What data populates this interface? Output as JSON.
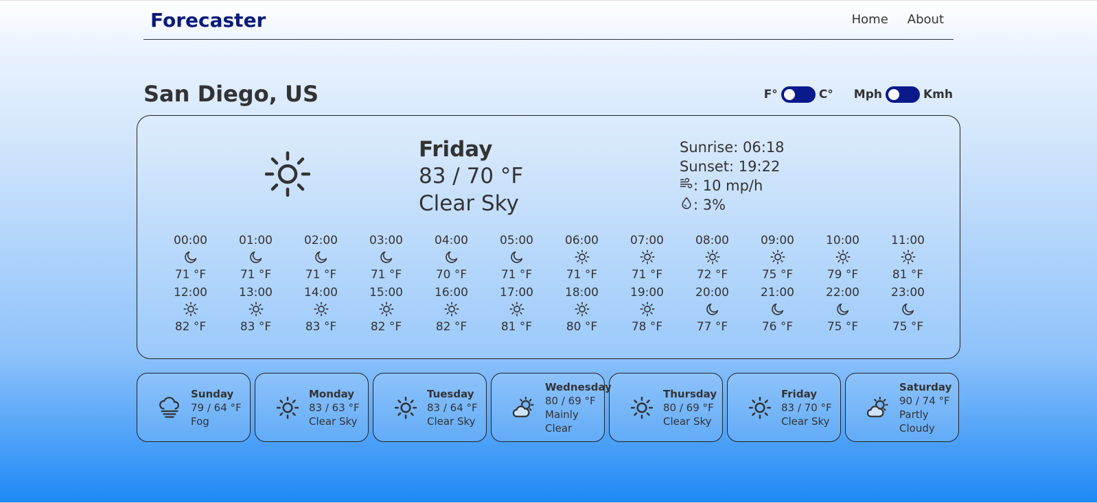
{
  "nav": {
    "brand": "Forecaster",
    "links": [
      "Home",
      "About"
    ]
  },
  "location": "San Diego, US",
  "toggles": {
    "temp": {
      "left": "F°",
      "right": "C°"
    },
    "speed": {
      "left": "Mph",
      "right": "Kmh"
    }
  },
  "current": {
    "day": "Friday",
    "temp": "83 / 70 °F",
    "condition": "Clear Sky",
    "icon": "sun-icon",
    "sunrise": "Sunrise: 06:18",
    "sunset": "Sunset: 19:22",
    "wind": ": 10 mp/h",
    "precip": ": 3%"
  },
  "hourly": [
    [
      {
        "time": "00:00",
        "icon": "moon",
        "temp": "71 °F"
      },
      {
        "time": "01:00",
        "icon": "moon",
        "temp": "71 °F"
      },
      {
        "time": "02:00",
        "icon": "moon",
        "temp": "71 °F"
      },
      {
        "time": "03:00",
        "icon": "moon",
        "temp": "71 °F"
      },
      {
        "time": "04:00",
        "icon": "moon",
        "temp": "70 °F"
      },
      {
        "time": "05:00",
        "icon": "moon",
        "temp": "71 °F"
      },
      {
        "time": "06:00",
        "icon": "sun",
        "temp": "71 °F"
      },
      {
        "time": "07:00",
        "icon": "sun",
        "temp": "71 °F"
      },
      {
        "time": "08:00",
        "icon": "sun",
        "temp": "72 °F"
      },
      {
        "time": "09:00",
        "icon": "sun",
        "temp": "75 °F"
      },
      {
        "time": "10:00",
        "icon": "sun",
        "temp": "79 °F"
      },
      {
        "time": "11:00",
        "icon": "sun",
        "temp": "81 °F"
      }
    ],
    [
      {
        "time": "12:00",
        "icon": "sun",
        "temp": "82 °F"
      },
      {
        "time": "13:00",
        "icon": "sun",
        "temp": "83 °F"
      },
      {
        "time": "14:00",
        "icon": "sun",
        "temp": "83 °F"
      },
      {
        "time": "15:00",
        "icon": "sun",
        "temp": "82 °F"
      },
      {
        "time": "16:00",
        "icon": "sun",
        "temp": "82 °F"
      },
      {
        "time": "17:00",
        "icon": "sun",
        "temp": "81 °F"
      },
      {
        "time": "18:00",
        "icon": "sun",
        "temp": "80 °F"
      },
      {
        "time": "19:00",
        "icon": "sun",
        "temp": "78 °F"
      },
      {
        "time": "20:00",
        "icon": "moon",
        "temp": "77 °F"
      },
      {
        "time": "21:00",
        "icon": "moon",
        "temp": "76 °F"
      },
      {
        "time": "22:00",
        "icon": "moon",
        "temp": "75 °F"
      },
      {
        "time": "23:00",
        "icon": "moon",
        "temp": "75 °F"
      }
    ]
  ],
  "daily": [
    {
      "day": "Sunday",
      "temp": "79 / 64 °F",
      "cond": [
        "Fog"
      ],
      "icon": "fog"
    },
    {
      "day": "Monday",
      "temp": "83 / 63 °F",
      "cond": [
        "Clear Sky"
      ],
      "icon": "sun"
    },
    {
      "day": "Tuesday",
      "temp": "83 / 64 °F",
      "cond": [
        "Clear Sky"
      ],
      "icon": "sun"
    },
    {
      "day": "Wednesday",
      "temp": "80 / 69 °F",
      "cond": [
        "Mainly",
        "Clear"
      ],
      "icon": "sun-cloud"
    },
    {
      "day": "Thursday",
      "temp": "80 / 69 °F",
      "cond": [
        "Clear Sky"
      ],
      "icon": "sun"
    },
    {
      "day": "Friday",
      "temp": "83 / 70 °F",
      "cond": [
        "Clear Sky"
      ],
      "icon": "sun"
    },
    {
      "day": "Saturday",
      "temp": "90 / 74 °F",
      "cond": [
        "Partly",
        "Cloudy"
      ],
      "icon": "sun-cloud"
    }
  ],
  "colors": {
    "brand": "#0a1a7a",
    "toggle": "#0a1a8a",
    "text": "#333333"
  }
}
